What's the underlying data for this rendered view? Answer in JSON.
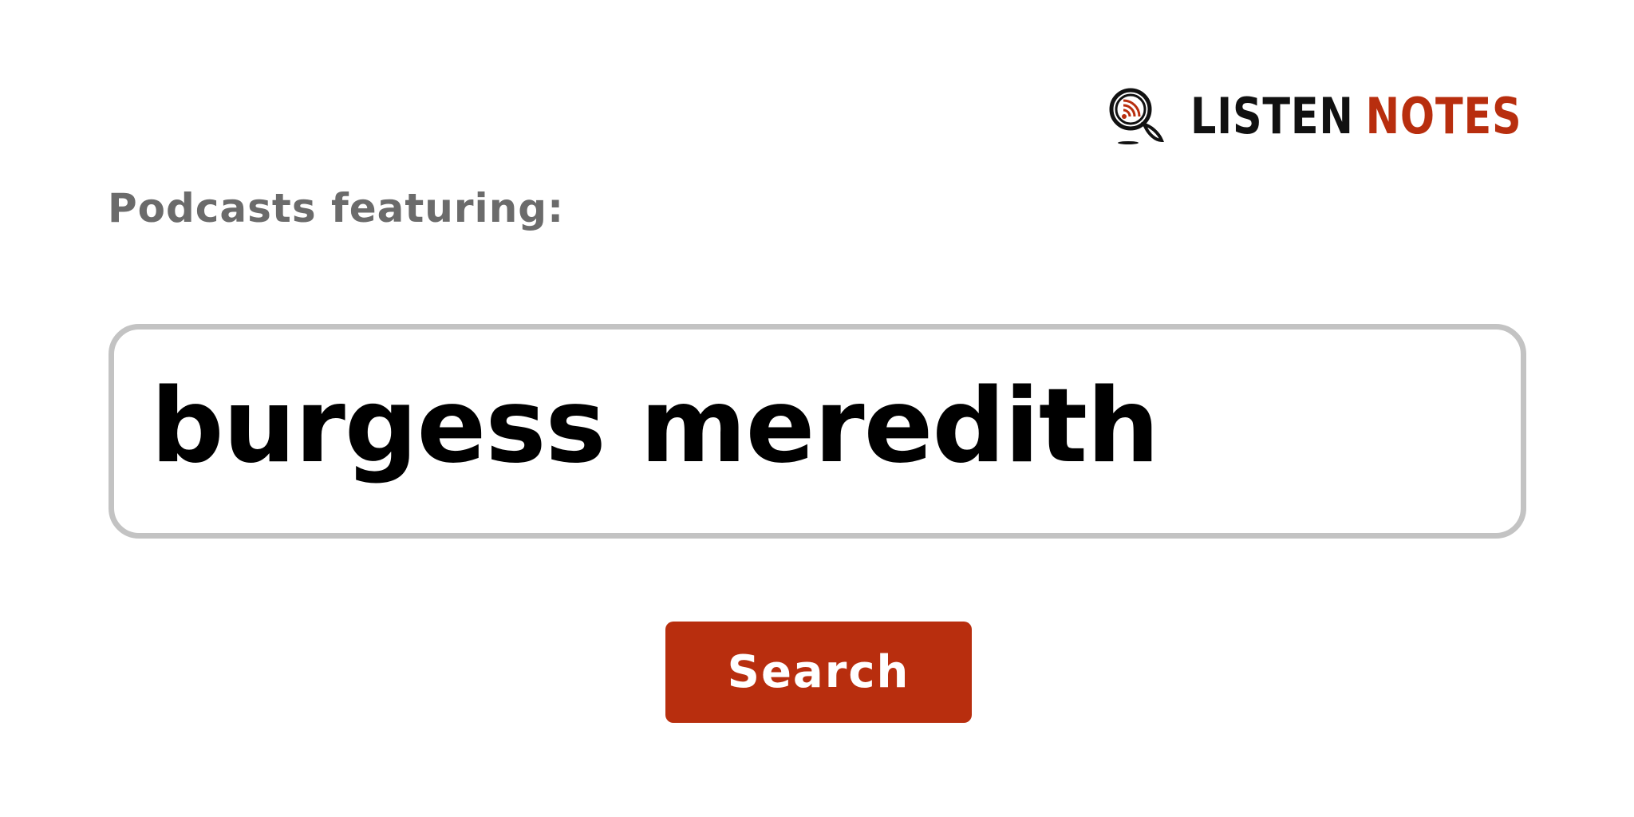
{
  "logo": {
    "word1": "LISTEN",
    "word2": "NOTES",
    "icon": "magnifier-podcast-icon",
    "colors": {
      "dark": "#111111",
      "accent": "#b82e0e"
    }
  },
  "subtitle": "Podcasts featuring:",
  "search": {
    "value": "burgess meredith",
    "button_label": "Search"
  },
  "colors": {
    "button_bg": "#b82e0e",
    "input_border": "#c3c3c3",
    "subtitle_text": "#6b6b6b"
  }
}
